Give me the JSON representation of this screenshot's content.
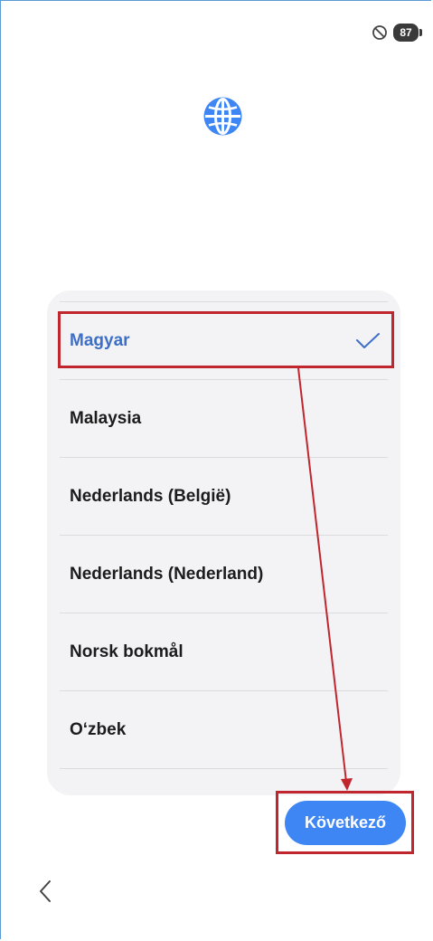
{
  "status_bar": {
    "dnd_icon": "do-not-disturb-icon",
    "battery_level": "87"
  },
  "header": {
    "icon": "globe-icon"
  },
  "language_list": {
    "items": [
      {
        "label": "Magyar",
        "selected": true
      },
      {
        "label": "Malaysia",
        "selected": false
      },
      {
        "label": "Nederlands (België)",
        "selected": false
      },
      {
        "label": "Nederlands (Nederland)",
        "selected": false
      },
      {
        "label": "Norsk bokmål",
        "selected": false
      },
      {
        "label": "O‘zbek",
        "selected": false
      }
    ]
  },
  "footer": {
    "next_label": "Következő",
    "back_icon": "chevron-left-icon"
  },
  "colors": {
    "accent": "#3f86f5",
    "selected_text": "#3e6fc7",
    "annotation": "#c0262d",
    "card_bg": "#f3f3f5"
  }
}
